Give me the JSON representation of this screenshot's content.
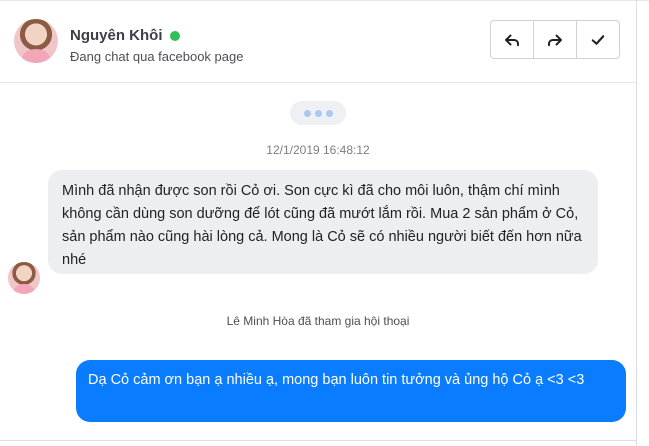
{
  "contact": {
    "name": "Nguyên Khôi",
    "status_color": "#2fbf56",
    "subtitle": "Đang chat qua facebook page"
  },
  "toolbar": {
    "reply_icon": "reply-icon",
    "forward_icon": "forward-icon",
    "done_icon": "check-icon"
  },
  "conversation": {
    "timestamp": "12/1/2019 16:48:12",
    "incoming_message": "Mình đã nhận được son rồi Cỏ ơi. Son cực kì đã cho môi luôn, thậm chí mình không cần dùng son dưỡng để lót cũng đã mướt lắm rồi. Mua 2 sản phẩm ở Cỏ, sản phẩm nào cũng hài lòng cả. Mong là Cỏ sẽ có nhiều người biết đến hơn nữa nhé",
    "system_note": "Lê Minh Hòa đã tham gia hội thoại",
    "outgoing_message": "Dạ Cỏ cảm ơn bạn ạ nhiều ạ, mong bạn luôn tin tưởng và ủng hộ Cỏ ạ <3 <3"
  },
  "colors": {
    "outgoing_bubble": "#0a7cff",
    "incoming_bubble": "#eceef1",
    "typing_dots": "#a7c8ef"
  }
}
